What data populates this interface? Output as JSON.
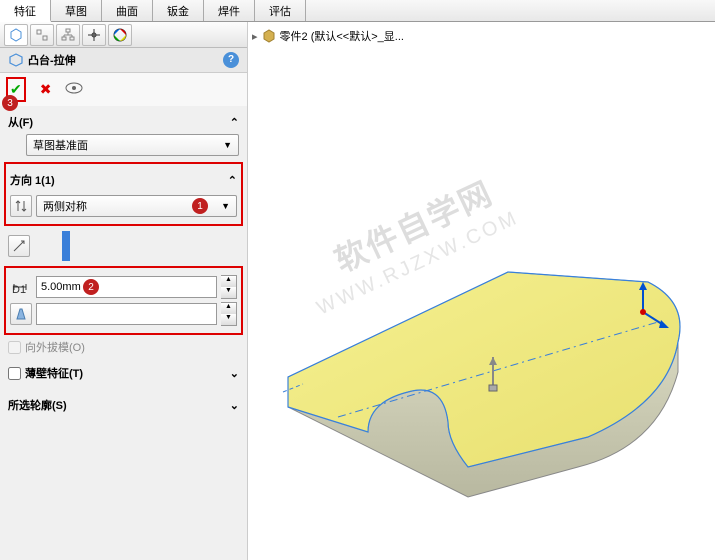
{
  "top_tabs": {
    "t0": "特征",
    "t1": "草图",
    "t2": "曲面",
    "t3": "钣金",
    "t4": "焊件",
    "t5": "评估"
  },
  "feature": {
    "title": "凸台-拉伸",
    "help_icon": "?"
  },
  "from_section": {
    "header": "从(F)",
    "value": "草图基准面"
  },
  "dir_section": {
    "header": "方向 1(1)",
    "end_condition": "两侧对称",
    "depth": "5.00mm",
    "draft_label": "向外拔模(O)"
  },
  "thin_section": {
    "header": "薄壁特征(T)"
  },
  "contour_section": {
    "header": "所选轮廓(S)"
  },
  "breadcrumb": {
    "part": "零件2  (默认<<默认>_显..."
  },
  "badges": {
    "b1": "1",
    "b2": "2",
    "b3": "3"
  },
  "watermark": {
    "line1": "软件自学网",
    "line2": "WWW.RJZXW.COM"
  }
}
